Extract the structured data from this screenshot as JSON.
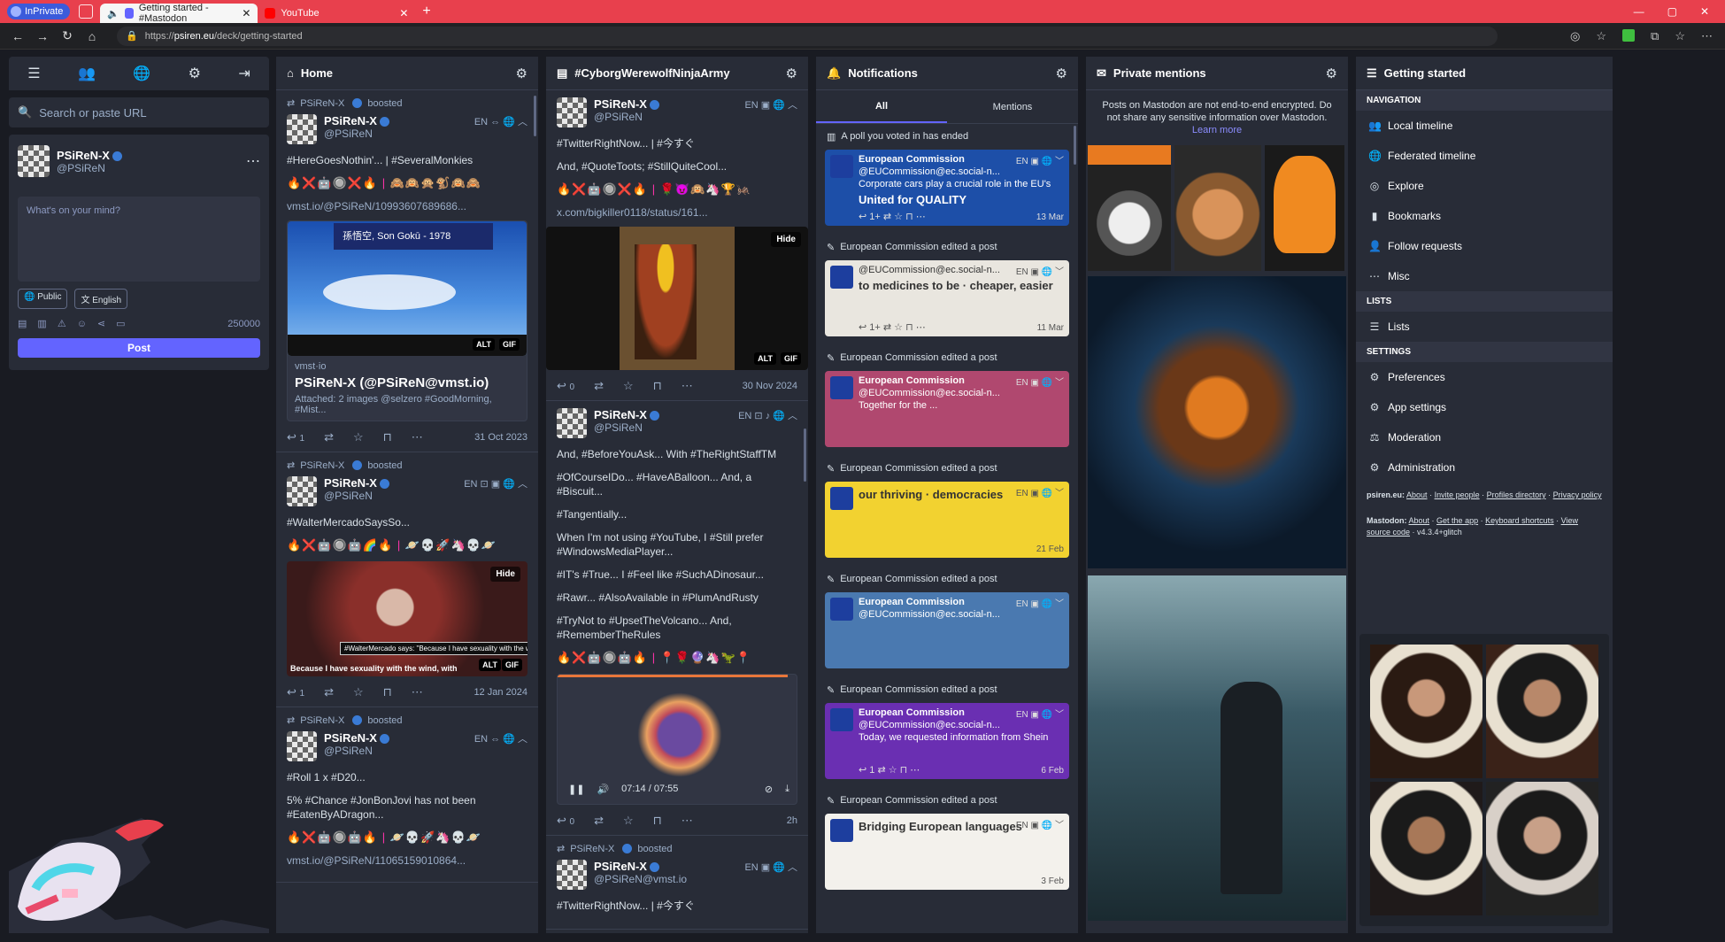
{
  "browser": {
    "inprivate_label": "InPrivate",
    "tabs": [
      {
        "title": "Getting started - #Mastodon",
        "active": true
      },
      {
        "title": "YouTube",
        "active": false
      }
    ],
    "url_prefix": "https://",
    "url_host": "psiren.eu",
    "url_path": "/deck/getting-started"
  },
  "drawer": {
    "search_placeholder": "Search or paste URL",
    "account_name": "PSiReN-X",
    "account_handle": "@PSiReN",
    "compose_placeholder": "What's on your mind?",
    "visibility": "Public",
    "language": "English",
    "char_count": "250000",
    "post_button": "Post"
  },
  "home": {
    "title": "Home",
    "statuses": [
      {
        "boost_by": "PSiReN-X",
        "boost_label": "boosted",
        "name": "PSiReN-X",
        "handle": "@PSiReN",
        "lang": "EN",
        "text": "#HereGoesNothin'... | #SeveralMonkies",
        "emojis": "🔥❌🤖🔘❌🔥 | 🙈🙉🙊🐒🙉🙈",
        "link": "vmst.io/@PSiReN/10993607689686...",
        "image_caption": "孫悟空, Son Gokū - 1978",
        "card_site": "vmst·io",
        "card_title": "PSiReN-X (@PSiReN@vmst.io)",
        "card_desc": "Attached: 2 images @selzero #GoodMorning, #Mist...",
        "replies": "1",
        "date": "31 Oct 2023"
      },
      {
        "boost_by": "PSiReN-X",
        "boost_label": "boosted",
        "name": "PSiReN-X",
        "handle": "@PSiReN",
        "lang": "EN",
        "text": "#WalterMercadoSaysSo...",
        "emojis": "🔥❌🤖🔘🤖🌈🔥 | 🪐💀🚀🦄💀🪐",
        "hide": "Hide",
        "subtitle": "Because I have sexuality with the wind, with",
        "tooltip": "#WalterMercado says: \"Because I have sexuality with the wind, with the wind!\"",
        "replies": "1",
        "date": "12 Jan 2024"
      },
      {
        "boost_by": "PSiReN-X",
        "boost_label": "boosted",
        "name": "PSiReN-X",
        "handle": "@PSiReN",
        "lang": "EN",
        "text1": "#Roll 1 x #D20...",
        "text2": "5% #Chance #JonBonJovi has not been #EatenByADragon...",
        "emojis": "🔥❌🤖🔘🤖🔥 | 🪐💀🚀🦄💀🪐",
        "link": "vmst.io/@PSiReN/11065159010864..."
      }
    ]
  },
  "hashtag": {
    "title": "#CyborgWerewolfNinjaArmy",
    "statuses": [
      {
        "name": "PSiReN-X",
        "handle": "@PSiReN",
        "lang": "EN",
        "text1": "#TwitterRightNow... | #今すぐ",
        "text2": "And, #QuoteToots; #StillQuiteCool...",
        "emojis": "🔥❌🤖🔘❌🔥 | 🌹😈🙉🦄🏆🦗",
        "link": "x.com/bigkiller0118/status/161...",
        "hide": "Hide",
        "replies": "0",
        "date": "30 Nov 2024"
      },
      {
        "name": "PSiReN-X",
        "handle": "@PSiReN",
        "lang": "EN",
        "lines": [
          "And, #BeforeYouAsk... With #TheRightStaffTM",
          "#OfCourseIDo... #HaveABalloon... And, a #Biscuit...",
          "#Tangentially...",
          "When I'm not using #YouTube, I #Still prefer #WindowsMediaPlayer...",
          "#IT's #True... I #Feel like #SuchADinosaur...",
          "#Rawr... #AlsoAvailable in #PlumAndRusty",
          "#TryNot to #UpsetTheVolcano... And, #RememberTheRules"
        ],
        "emojis": "🔥❌🤖🔘🤖🔥 | 📍🌹🔮🦄🦖📍",
        "time_current": "07:14",
        "time_total": "07:55",
        "replies": "0",
        "date": "2h"
      },
      {
        "boost_by": "PSiReN-X",
        "boost_label": "boosted",
        "name": "PSiReN-X",
        "handle": "@PSiReN@vmst.io",
        "lang": "EN",
        "text1": "#TwitterRightNow... | #今すぐ"
      }
    ]
  },
  "notifications": {
    "title": "Notifications",
    "tab_all": "All",
    "tab_mentions": "Mentions",
    "items": [
      {
        "head": "A poll you voted in has ended",
        "name": "European Commission",
        "handle": "@EUCommission@ec.social-n...",
        "body": "Corporate cars play a crucial role in the EU's",
        "overlay": "United for QUALITY",
        "lang": "EN",
        "date": "13 Mar",
        "replies": "1+",
        "bg": "#1d4fa8"
      },
      {
        "head": "European Commission edited a post",
        "overlay": "to medicines to be · cheaper, easier",
        "handle": "@EUCommission@ec.social-n...",
        "lang": "EN",
        "date": "11 Mar",
        "replies": "1+",
        "bg": "#e9e6df"
      },
      {
        "head": "European Commission edited a post",
        "name": "European Commission",
        "handle": "@EUCommission@ec.social-n...",
        "body": "Together for the ...",
        "lang": "EN",
        "bg": "#b0486f"
      },
      {
        "head": "European Commission edited a post",
        "overlay": "our thriving · democracies",
        "lang": "EN",
        "date": "21 Feb",
        "bg": "#f2d230"
      },
      {
        "head": "European Commission edited a post",
        "name": "European Commission",
        "handle": "@EUCommission@ec.social-n...",
        "lang": "EN",
        "bg": "#4a79b0"
      },
      {
        "head": "European Commission edited a post",
        "name": "European Commission",
        "handle": "@EUCommission@ec.social-n...",
        "body": "Today, we requested information from Shein",
        "lang": "EN",
        "date": "6 Feb",
        "replies": "1",
        "bg": "#6a2fb2"
      },
      {
        "head": "European Commission edited a post",
        "overlay": "Bridging European languages",
        "lang": "EN",
        "date": "3 Feb",
        "bg": "#f3f1ec"
      }
    ]
  },
  "mentions": {
    "title": "Private mentions",
    "info": "Posts on Mastodon are not end-to-end encrypted. Do not share any sensitive information over Mastodon.",
    "learn_more": "Learn more"
  },
  "getting_started": {
    "title": "Getting started",
    "nav_header": "Navigation",
    "nav": [
      {
        "label": "Local timeline",
        "icon": "users-icon"
      },
      {
        "label": "Federated timeline",
        "icon": "globe-icon"
      },
      {
        "label": "Explore",
        "icon": "compass-icon"
      },
      {
        "label": "Bookmarks",
        "icon": "bookmark-icon"
      },
      {
        "label": "Follow requests",
        "icon": "user-plus-icon"
      },
      {
        "label": "Misc",
        "icon": "ellipsis-icon"
      }
    ],
    "lists_header": "Lists",
    "lists_item": "Lists",
    "settings_header": "Settings",
    "settings": [
      {
        "label": "Preferences",
        "icon": "cog-icon"
      },
      {
        "label": "App settings",
        "icon": "cogs-icon"
      },
      {
        "label": "Moderation",
        "icon": "gavel-icon"
      },
      {
        "label": "Administration",
        "icon": "admin-icon"
      }
    ],
    "footer_site": "psiren.eu:",
    "footer_site_links": [
      "About",
      "Invite people",
      "Profiles directory",
      "Privacy policy"
    ],
    "footer_mastodon": "Mastodon:",
    "footer_mastodon_links": [
      "About",
      "Get the app",
      "Keyboard shortcuts",
      "View source code"
    ],
    "version": "v4.3.4+glitch"
  },
  "colors": {
    "accent": "#6364ff",
    "column_bg": "#282c37",
    "page_bg": "#191b22",
    "titlebar": "#e8404d"
  }
}
